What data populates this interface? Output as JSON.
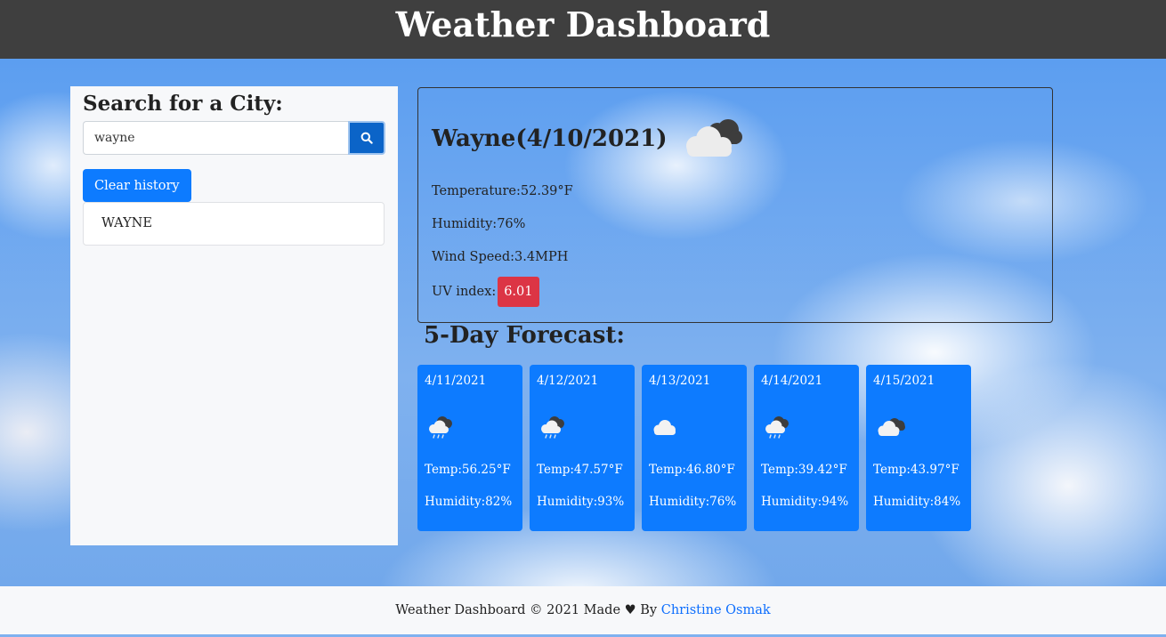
{
  "header": {
    "title": "Weather Dashboard"
  },
  "search": {
    "heading": "Search for a City:",
    "value": "wayne",
    "button_icon": "search-icon",
    "clear_label": "Clear history",
    "history": [
      "WAYNE"
    ]
  },
  "current": {
    "city_date": "Wayne(4/10/2021)",
    "icon": "cloud-icon",
    "temperature": "Temperature:52.39°F",
    "humidity": "Humidity:76%",
    "wind": "Wind Speed:3.4MPH",
    "uv_label": "UV index:",
    "uv_value": "6.01",
    "uv_color": "#dc3545"
  },
  "forecast": {
    "title": "5-Day Forecast:",
    "days": [
      {
        "date": "4/11/2021",
        "icon": "rain-cloud-icon",
        "temp": "Temp:56.25°F",
        "humidity": "Humidity:82%"
      },
      {
        "date": "4/12/2021",
        "icon": "rain-cloud-icon",
        "temp": "Temp:47.57°F",
        "humidity": "Humidity:93%"
      },
      {
        "date": "4/13/2021",
        "icon": "cloud-icon",
        "temp": "Temp:46.80°F",
        "humidity": "Humidity:76%"
      },
      {
        "date": "4/14/2021",
        "icon": "rain-cloud-icon",
        "temp": "Temp:39.42°F",
        "humidity": "Humidity:94%"
      },
      {
        "date": "4/15/2021",
        "icon": "cloud-icon",
        "temp": "Temp:43.97°F",
        "humidity": "Humidity:84%"
      }
    ]
  },
  "footer": {
    "text": "Weather Dashboard © 2021 Made",
    "heart": "♥",
    "by": "By",
    "author": "Christine Osmak"
  },
  "colors": {
    "header_bg": "#3f3f3f",
    "card_bg": "#0d7bff",
    "search_button": "#0b64c8",
    "link": "#0d6efd"
  }
}
